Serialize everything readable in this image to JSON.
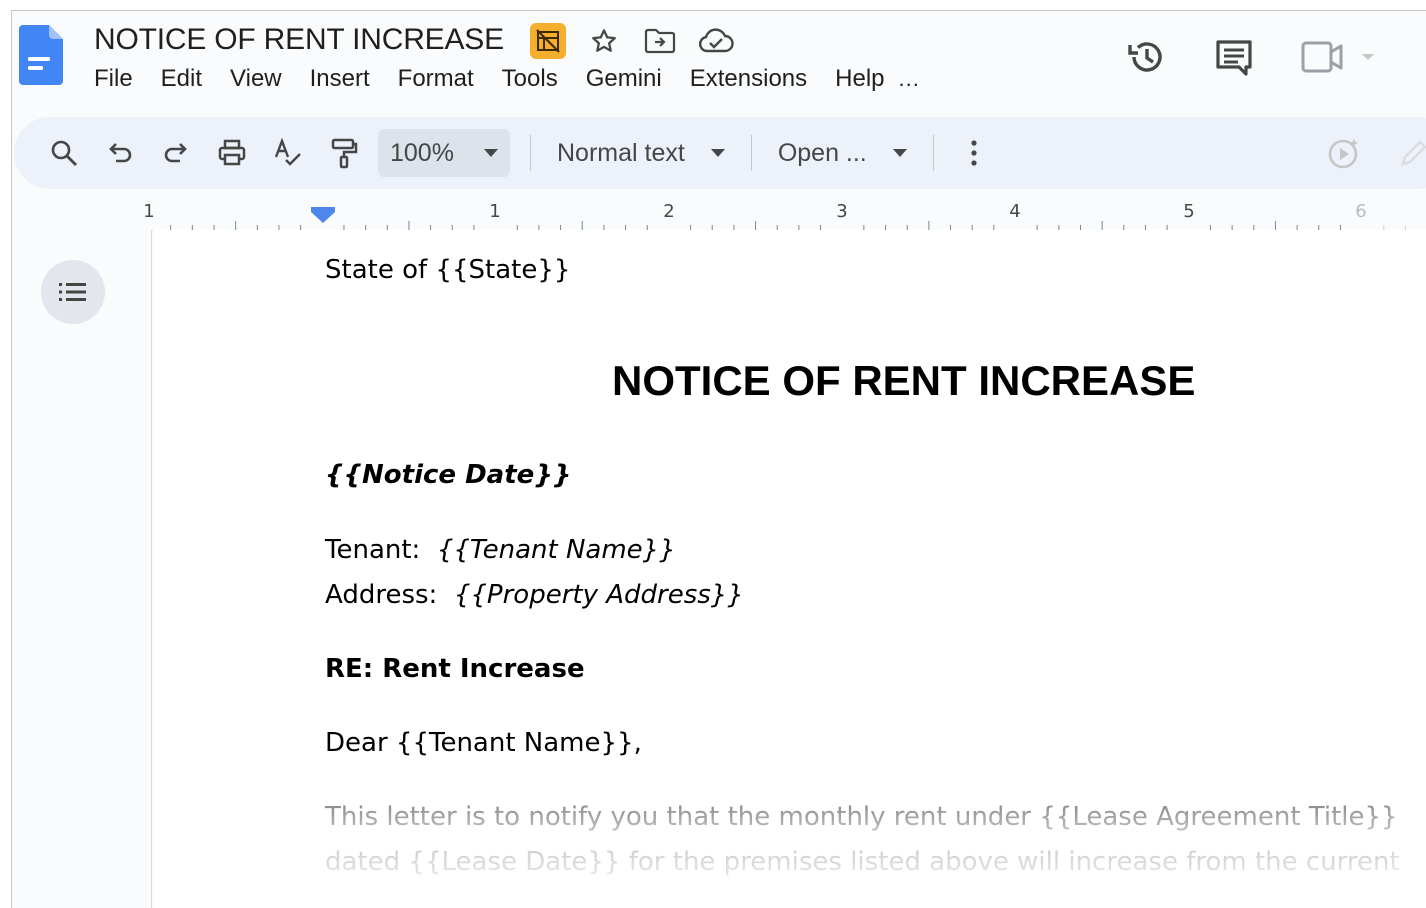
{
  "document": {
    "title": "NOTICE OF RENT INCREASE"
  },
  "menu": {
    "items": [
      "File",
      "Edit",
      "View",
      "Insert",
      "Format",
      "Tools",
      "Gemini",
      "Extensions",
      "Help"
    ],
    "more": "..."
  },
  "toolbar": {
    "zoom": "100%",
    "style": "Normal text",
    "font": "Open ..."
  },
  "ruler": {
    "labels": [
      "1",
      "1",
      "2",
      "3",
      "4",
      "5",
      "6"
    ]
  },
  "content": {
    "state_line": "State of {{State}}",
    "heading": "NOTICE OF RENT INCREASE",
    "notice_date": "{{Notice Date}}",
    "tenant_label": "Tenant:",
    "tenant_value": "{{Tenant Name}}",
    "address_label": "Address:",
    "address_value": "{{Property Address}}",
    "re_line": "RE: Rent Increase",
    "salutation": "Dear {{Tenant Name}},",
    "body_line1": "This letter is to notify you that the monthly rent under {{Lease Agreement Title}}",
    "body_line2": "dated {{Lease Date}} for the premises listed above will increase from the current"
  },
  "icons": {
    "logo": "google-docs-logo",
    "accent": "#4285f4",
    "tag_color": "#f6ae2d"
  }
}
